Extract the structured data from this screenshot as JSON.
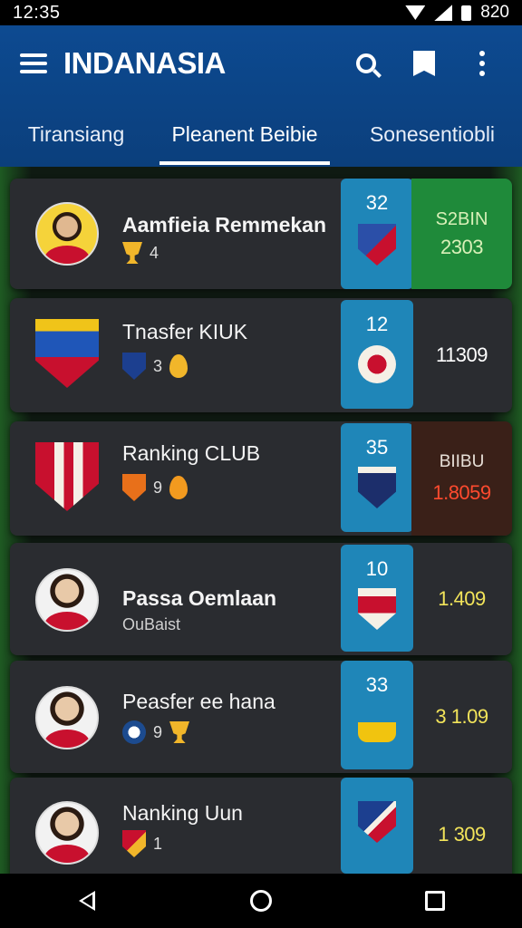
{
  "status_bar": {
    "time": "12:35",
    "battery_text": "820"
  },
  "app_bar": {
    "title": "INDANASIA",
    "icons": [
      "menu-icon",
      "search-icon",
      "bookmark-icon",
      "more-vert-icon"
    ]
  },
  "tabs": [
    {
      "label": "Tiransiang",
      "selected": false
    },
    {
      "label": "Pleanent Beibie",
      "selected": true
    },
    {
      "label": "Sonesentiobli",
      "selected": false
    }
  ],
  "rows": [
    {
      "name": "Aamfieia Remmekan",
      "sub_text": "4",
      "rank": "32",
      "value_label": "S2BIN",
      "value": "2303",
      "value_color": "#d9f0b8",
      "value_bg": "#1f8a3a",
      "thumb": "player-avatar",
      "badge_colors": [
        "#2b4fa8",
        "#c8102e"
      ],
      "sub_icons": [
        "trophy-icon"
      ]
    },
    {
      "name": "Tnasfer KIUK",
      "sub_text": "3",
      "rank": "12",
      "value_label": "",
      "value": "11309",
      "value_color": "#ffffff",
      "value_bg": "#2a2c30",
      "thumb": "club-crest",
      "badge_colors": [
        "#f5f0e6",
        "#c8102e"
      ],
      "sub_icons": [
        "mini-crest-icon",
        "flame-icon"
      ]
    },
    {
      "name": "Ranking CLUB",
      "sub_text": "9",
      "rank": "35",
      "value_label": "BIIBU",
      "value": "1.8059",
      "value_color": "#ff4a2e",
      "value_bg": "#3a2018",
      "thumb": "club-crest",
      "badge_colors": [
        "#1c2e6b",
        "#c8102e"
      ],
      "sub_icons": [
        "mini-crest-icon",
        "flame-icon"
      ]
    },
    {
      "name": "Passa Oemlaan",
      "sub_text": "OuBaist",
      "rank": "10",
      "value_label": "",
      "value": "1.409",
      "value_color": "#f2e45a",
      "value_bg": "#2a2c30",
      "thumb": "player-avatar",
      "badge_colors": [
        "#f5f0e6",
        "#c8102e"
      ],
      "sub_icons": []
    },
    {
      "name": "Peasfer ee hana",
      "sub_text": "9",
      "rank": "33",
      "value_label": "",
      "value": "3 1.09",
      "value_color": "#f2e45a",
      "value_bg": "#2a2c30",
      "thumb": "player-avatar",
      "badge_colors": [
        "#f1c40f",
        "#1f86b8"
      ],
      "sub_icons": [
        "ball-icon",
        "trophy-icon"
      ]
    },
    {
      "name": "Nanking Uun",
      "sub_text": "1",
      "rank": "",
      "value_label": "",
      "value": "1 309",
      "value_color": "#f2e45a",
      "value_bg": "#2a2c30",
      "thumb": "player-avatar",
      "badge_colors": [
        "#1c3f8f",
        "#c8102e"
      ],
      "sub_icons": [
        "mini-crest-icon"
      ]
    }
  ],
  "nav_bar": {
    "buttons": [
      "back-icon",
      "home-icon",
      "recents-icon"
    ]
  }
}
